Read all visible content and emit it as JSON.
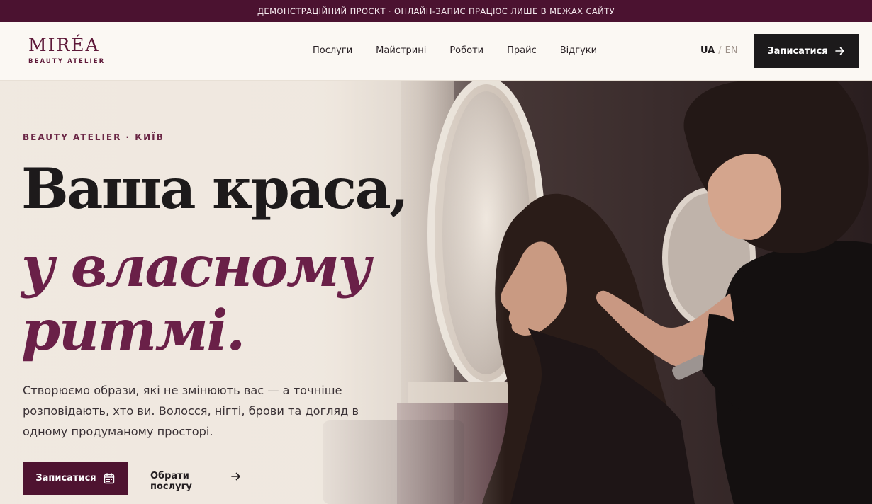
{
  "announcement": "ДЕМОНСТРАЦІЙНИЙ ПРОЄКТ · ОНЛАЙН-ЗАПИС ПРАЦЮЄ ЛИШЕ В МЕЖАХ САЙТУ",
  "brand": {
    "name": "MIRÉA",
    "tagline": "BEAUTY ATELIER"
  },
  "nav": [
    "Послуги",
    "Майстрині",
    "Роботи",
    "Прайс",
    "Відгуки"
  ],
  "languages": {
    "active": "UA",
    "separator": "/",
    "other": "EN"
  },
  "header_cta": {
    "label": "Записатися",
    "icon": "arrow-right-icon"
  },
  "hero": {
    "eyebrow": "BEAUTY ATELIER · КИЇВ",
    "title_line1": "Ваша краса,",
    "title_line2": "у власному",
    "title_line3": "ритмі.",
    "lead": "Створюємо образи, які не змінюють вас — а точніше розповідають, хто ви. Волосся, нігті, брови та догляд в одному продуманому просторі.",
    "primary_button": {
      "label": "Записатися",
      "icon": "calendar-icon"
    },
    "secondary_link": {
      "label": "Обрати послугу",
      "icon": "arrow-right-icon"
    }
  },
  "colors": {
    "brand_plum": "#4b1230",
    "accent_plum": "#6a2048",
    "dark_button": "#1c1a1b",
    "cream_bg": "#fbf8f3"
  }
}
